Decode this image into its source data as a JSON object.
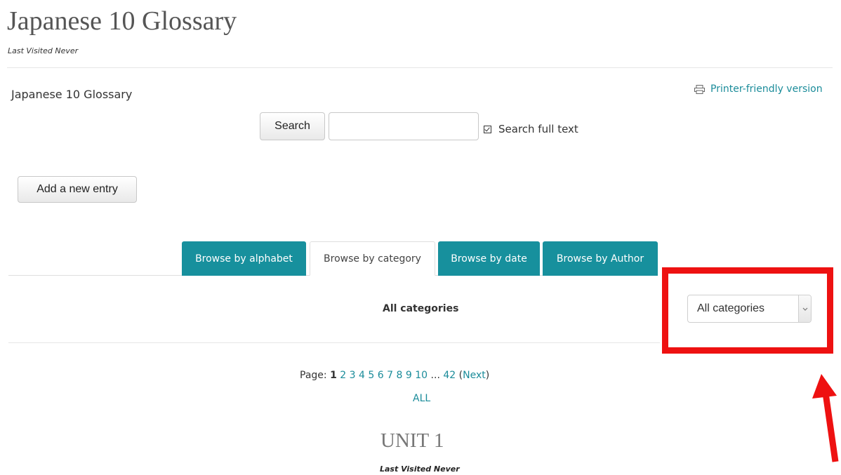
{
  "header": {
    "title": "Japanese 10 Glossary",
    "subtitle": "Last Visited Never"
  },
  "glossary": {
    "name": "Japanese 10 Glossary",
    "printer_link": "Printer-friendly version"
  },
  "search": {
    "button_label": "Search",
    "input_value": "",
    "fulltext_label": "Search full text",
    "fulltext_checked": true
  },
  "actions": {
    "add_entry_label": "Add a new entry"
  },
  "tabs": [
    {
      "label": "Browse by alphabet",
      "active": false
    },
    {
      "label": "Browse by category",
      "active": true
    },
    {
      "label": "Browse by date",
      "active": false
    },
    {
      "label": "Browse by Author",
      "active": false
    }
  ],
  "category": {
    "label": "All categories",
    "select_value": "All categories"
  },
  "pagination": {
    "prefix": "Page:",
    "current": "1",
    "pages": [
      "2",
      "3",
      "4",
      "5",
      "6",
      "7",
      "8",
      "9",
      "10"
    ],
    "ellipsis": "...",
    "last": "42",
    "next_label": "Next",
    "all_label": "ALL"
  },
  "unit": {
    "title": "UNIT 1",
    "subtitle": "Last Visited Never"
  },
  "colors": {
    "accent": "#17909d",
    "link": "#1b8c9a",
    "highlight": "#ee1111"
  },
  "icons": {
    "printer": "printer-icon",
    "checkbox": "checkbox-checked-icon",
    "select_arrow": "chevron-down-icon",
    "annotation_arrow": "arrow-up-icon"
  }
}
